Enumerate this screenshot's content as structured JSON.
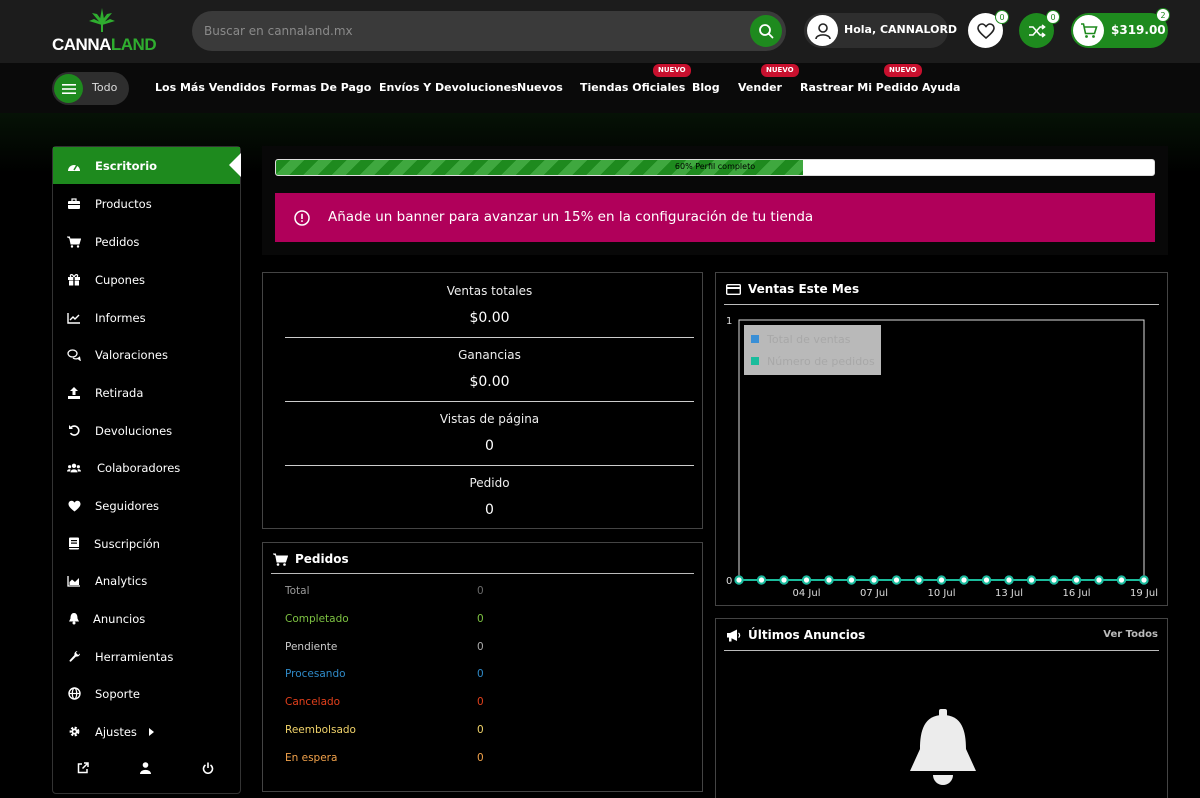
{
  "header": {
    "logo": {
      "part1": "CANNA",
      "part2": "LAND"
    },
    "search_placeholder": "Buscar en cannaland.mx",
    "user_greeting": "Hola, CANNALORD",
    "wishlist_count": "0",
    "compare_count": "0",
    "cart_total": "$319.00",
    "cart_count": "2"
  },
  "nav": {
    "menu_label": "Todo",
    "items": [
      {
        "label": "Los Más Vendidos"
      },
      {
        "label": "Formas De Pago"
      },
      {
        "label": "Envíos Y Devoluciones"
      },
      {
        "label": "Nuevos"
      },
      {
        "label": "Tiendas Oficiales",
        "badge": "NUEVO"
      },
      {
        "label": "Blog"
      },
      {
        "label": "Vender",
        "badge": "NUEVO"
      },
      {
        "label": "Rastrear Mi Pedido",
        "badge": "NUEVO"
      },
      {
        "label": "Ayuda"
      }
    ]
  },
  "sidebar": {
    "items": [
      {
        "label": "Escritorio",
        "icon": "dashboard-icon",
        "active": true
      },
      {
        "label": "Productos",
        "icon": "briefcase-icon"
      },
      {
        "label": "Pedidos",
        "icon": "cart-icon"
      },
      {
        "label": "Cupones",
        "icon": "gift-icon"
      },
      {
        "label": "Informes",
        "icon": "line-chart-icon"
      },
      {
        "label": "Valoraciones",
        "icon": "comments-icon"
      },
      {
        "label": "Retirada",
        "icon": "upload-icon"
      },
      {
        "label": "Devoluciones",
        "icon": "undo-icon"
      },
      {
        "label": "Colaboradores",
        "icon": "users-icon"
      },
      {
        "label": "Seguidores",
        "icon": "heart-icon"
      },
      {
        "label": "Suscripción",
        "icon": "book-icon"
      },
      {
        "label": "Analytics",
        "icon": "area-chart-icon"
      },
      {
        "label": "Anuncios",
        "icon": "bell-icon"
      },
      {
        "label": "Herramientas",
        "icon": "wrench-icon"
      },
      {
        "label": "Soporte",
        "icon": "globe-icon"
      },
      {
        "label": "Ajustes",
        "icon": "gear-icon",
        "has_submenu": true
      }
    ],
    "footer_icons": [
      "external-link-icon",
      "user-icon",
      "power-icon"
    ]
  },
  "profile": {
    "progress_percent": 60,
    "progress_text": "60% Perfil completo",
    "alert_text": "Añade un banner para avanzar un 15% en la configuración de tu tienda"
  },
  "stats": [
    {
      "label": "Ventas totales",
      "value": "$0.00"
    },
    {
      "label": "Ganancias",
      "value": "$0.00"
    },
    {
      "label": "Vistas de página",
      "value": "0"
    },
    {
      "label": "Pedido",
      "value": "0"
    }
  ],
  "orders": {
    "title": "Pedidos",
    "rows": [
      {
        "label": "Total",
        "value": "0",
        "color": "#9a9a9a",
        "value_color": "#6a6a6a"
      },
      {
        "label": "Completado",
        "value": "0",
        "color": "#7dc242",
        "value_color": "#7dc242"
      },
      {
        "label": "Pendiente",
        "value": "0",
        "color": "#cccccc",
        "value_color": "#aaaaaa"
      },
      {
        "label": "Procesando",
        "value": "0",
        "color": "#2f8ac8",
        "value_color": "#2f8ac8"
      },
      {
        "label": "Cancelado",
        "value": "0",
        "color": "#e2401c",
        "value_color": "#e2401c"
      },
      {
        "label": "Reembolsado",
        "value": "0",
        "color": "#f1d36a",
        "value_color": "#f1d36a"
      },
      {
        "label": "En espera",
        "value": "0",
        "color": "#f0a14a",
        "value_color": "#f0a14a"
      }
    ]
  },
  "sales_chart": {
    "title": "Ventas Este Mes",
    "chart_data": {
      "type": "line",
      "ylim": [
        0,
        1
      ],
      "yticks": [
        "0",
        "1"
      ],
      "x_points": 19,
      "xtick_labels": [
        "04 Jul",
        "07 Jul",
        "10 Jul",
        "13 Jul",
        "16 Jul",
        "19 Jul"
      ],
      "xtick_indices": [
        3,
        6,
        9,
        12,
        15,
        18
      ],
      "legend_position": "top-left",
      "series": [
        {
          "name": "Total de ventas",
          "color": "#3a8fd6",
          "values": [
            0,
            0,
            0,
            0,
            0,
            0,
            0,
            0,
            0,
            0,
            0,
            0,
            0,
            0,
            0,
            0,
            0,
            0,
            0
          ]
        },
        {
          "name": "Número de pedidos",
          "color": "#1abc9c",
          "values": [
            0,
            0,
            0,
            0,
            0,
            0,
            0,
            0,
            0,
            0,
            0,
            0,
            0,
            0,
            0,
            0,
            0,
            0,
            0
          ]
        }
      ]
    }
  },
  "announcements": {
    "title": "Últimos Anuncios",
    "view_all": "Ver Todos"
  }
}
